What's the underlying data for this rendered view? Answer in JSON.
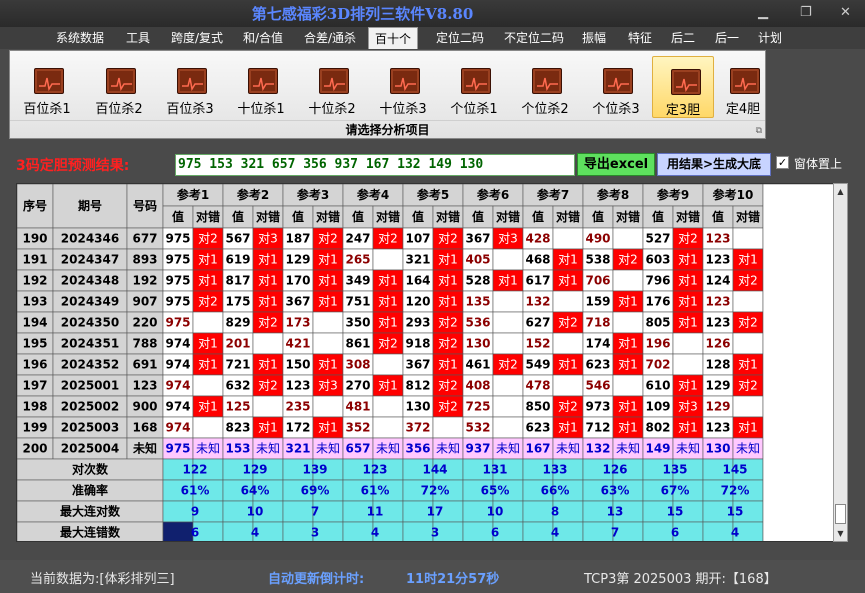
{
  "title": "第七感福彩3D排列三软件V8.80",
  "menu": [
    "系统数据",
    "工具",
    "跨度/复式",
    "和/合值",
    "合差/通杀",
    "百十个",
    "定位二码",
    "不定位二码",
    "振幅",
    "特征",
    "后二",
    "后一",
    "计划"
  ],
  "active_menu": 5,
  "ribbon": {
    "buttons": [
      "百位杀1",
      "百位杀2",
      "百位杀3",
      "十位杀1",
      "十位杀2",
      "十位杀3",
      "个位杀1",
      "个位杀2",
      "个位杀3",
      "定3胆",
      "定4胆"
    ],
    "active": 9,
    "caption": "请选择分析项目"
  },
  "prediction": {
    "label": "3码定胆预测结果:",
    "values": "975 153 321 657 356 937 167 132 149 130"
  },
  "buttons": {
    "excel": "导出excel",
    "generate": "用结果>生成大底"
  },
  "checkbox": {
    "label": "窗体置上",
    "checked": "✓"
  },
  "colors": {
    "hit": "#ff0000",
    "miss_text": "#8b0000",
    "pending_bg": "#ffc8ff",
    "stats_bg": "#6ee8e8",
    "stats_text": "#0000cc",
    "header_bg": "#d4d4d4"
  },
  "table": {
    "headers": {
      "seq": "序号",
      "period": "期号",
      "number": "号码",
      "group": [
        "参考1",
        "参考2",
        "参考3",
        "参考4",
        "参考5",
        "参考6",
        "参考7",
        "参考8",
        "参考9",
        "参考10"
      ],
      "value": "值",
      "check": "对错"
    },
    "rows": [
      {
        "seq": "190",
        "period": "2024346",
        "num": "677",
        "v": [
          "975",
          "567",
          "187",
          "247",
          "107",
          "367",
          "428",
          "490",
          "527",
          "123"
        ],
        "c": [
          "对2",
          "对3",
          "对2",
          "对2",
          "对2",
          "对3",
          "",
          "",
          "对2",
          ""
        ]
      },
      {
        "seq": "191",
        "period": "2024347",
        "num": "893",
        "v": [
          "975",
          "619",
          "129",
          "265",
          "321",
          "405",
          "468",
          "538",
          "603",
          "123"
        ],
        "c": [
          "对1",
          "对1",
          "对1",
          "",
          "对1",
          "",
          "对1",
          "对2",
          "对1",
          "对1"
        ]
      },
      {
        "seq": "192",
        "period": "2024348",
        "num": "192",
        "v": [
          "975",
          "817",
          "170",
          "349",
          "164",
          "528",
          "617",
          "706",
          "796",
          "124"
        ],
        "c": [
          "对1",
          "对1",
          "对1",
          "对1",
          "对1",
          "对1",
          "对1",
          "",
          "对1",
          "对2"
        ]
      },
      {
        "seq": "193",
        "period": "2024349",
        "num": "907",
        "v": [
          "975",
          "175",
          "367",
          "751",
          "120",
          "135",
          "132",
          "159",
          "176",
          "123"
        ],
        "c": [
          "对2",
          "对1",
          "对1",
          "对1",
          "对1",
          "",
          "",
          "对1",
          "对1",
          ""
        ]
      },
      {
        "seq": "194",
        "period": "2024350",
        "num": "220",
        "v": [
          "975",
          "829",
          "173",
          "350",
          "293",
          "536",
          "627",
          "718",
          "805",
          "123"
        ],
        "c": [
          "",
          "对2",
          "",
          "对1",
          "对2",
          "",
          "对2",
          "",
          "对1",
          "对2"
        ]
      },
      {
        "seq": "195",
        "period": "2024351",
        "num": "788",
        "v": [
          "974",
          "201",
          "421",
          "861",
          "918",
          "130",
          "152",
          "174",
          "196",
          "126"
        ],
        "c": [
          "对1",
          "",
          "",
          "对2",
          "对2",
          "",
          "",
          "对1",
          "",
          ""
        ]
      },
      {
        "seq": "196",
        "period": "2024352",
        "num": "691",
        "v": [
          "974",
          "721",
          "150",
          "308",
          "367",
          "461",
          "549",
          "623",
          "702",
          "128"
        ],
        "c": [
          "对1",
          "对1",
          "对1",
          "",
          "对1",
          "对2",
          "对1",
          "对1",
          "",
          "对1"
        ]
      },
      {
        "seq": "197",
        "period": "2025001",
        "num": "123",
        "v": [
          "974",
          "632",
          "123",
          "270",
          "812",
          "408",
          "478",
          "546",
          "610",
          "129"
        ],
        "c": [
          "",
          "对2",
          "对3",
          "对1",
          "对2",
          "",
          "",
          "",
          "对1",
          "对2"
        ]
      },
      {
        "seq": "198",
        "period": "2025002",
        "num": "900",
        "v": [
          "974",
          "125",
          "235",
          "481",
          "130",
          "725",
          "850",
          "973",
          "109",
          "129"
        ],
        "c": [
          "对1",
          "",
          "",
          "",
          "对2",
          "",
          "对2",
          "对1",
          "对3",
          ""
        ]
      },
      {
        "seq": "199",
        "period": "2025003",
        "num": "168",
        "v": [
          "974",
          "823",
          "172",
          "352",
          "372",
          "532",
          "623",
          "712",
          "802",
          "123"
        ],
        "c": [
          "",
          "对1",
          "对1",
          "",
          "",
          "",
          "对1",
          "对1",
          "对1",
          "对1"
        ]
      },
      {
        "seq": "200",
        "period": "2025004",
        "num": "未知",
        "v": [
          "975",
          "153",
          "321",
          "657",
          "356",
          "937",
          "167",
          "132",
          "149",
          "130"
        ],
        "c": [
          "未知",
          "未知",
          "未知",
          "未知",
          "未知",
          "未知",
          "未知",
          "未知",
          "未知",
          "未知"
        ]
      }
    ],
    "stats": [
      {
        "label": "对次数",
        "values": [
          "122",
          "129",
          "139",
          "123",
          "144",
          "131",
          "133",
          "126",
          "135",
          "145"
        ]
      },
      {
        "label": "准确率",
        "values": [
          "61%",
          "64%",
          "69%",
          "61%",
          "72%",
          "65%",
          "66%",
          "63%",
          "67%",
          "72%"
        ]
      },
      {
        "label": "最大连对数",
        "values": [
          "9",
          "10",
          "7",
          "11",
          "17",
          "10",
          "8",
          "13",
          "15",
          "15"
        ]
      },
      {
        "label": "最大连错数",
        "values": [
          "6",
          "4",
          "3",
          "4",
          "3",
          "6",
          "4",
          "7",
          "6",
          "4"
        ]
      }
    ]
  },
  "status": {
    "current_label": "当前数据为:[体彩排列三]",
    "countdown_label": "自动更新倒计时:",
    "countdown_value": "11时21分57秒",
    "period_info": "TCP3第 2025003 期开:【168】"
  }
}
